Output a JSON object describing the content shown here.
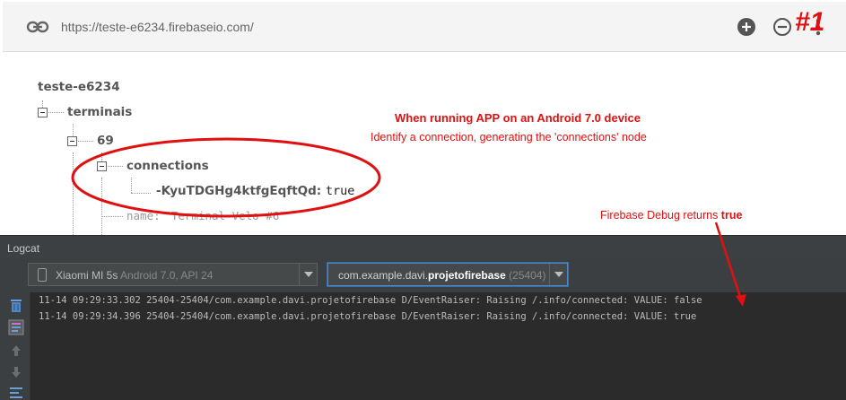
{
  "urlbar": {
    "url": "https://teste-e6234.firebaseio.com/",
    "link_icon": "link-icon",
    "add_icon": "add-circle-icon",
    "remove_icon": "remove-circle-icon",
    "more_icon": "more-vert-icon"
  },
  "tree": {
    "root": "teste-e6234",
    "terminais": "terminais",
    "id_69": "69",
    "connections": "connections",
    "connection_key": "-KyuTDGHg4ktfgEqftQd:",
    "connection_value": "true",
    "name_key": "name:",
    "name_value": "\"Terminal Velo #6\""
  },
  "annotations": {
    "badge": "#1",
    "line1": "When running APP on an Android 7.0 device",
    "line2": "Identify a connection, generating the 'connections' node",
    "debug_prefix": "Firebase Debug returns ",
    "debug_bold": "true"
  },
  "logcat": {
    "title": "Logcat",
    "device_name": "Xiaomi MI 5s",
    "device_detail": "Android 7.0, API 24",
    "process_prefix": "com.example.davi.",
    "process_bold": "projetofirebase",
    "process_pid": "(25404)",
    "lines": [
      "11-14 09:29:33.302 25404-25404/com.example.davi.projetofirebase D/EventRaiser: Raising /.info/connected: VALUE: false",
      "11-14 09:29:34.396 25404-25404/com.example.davi.projetofirebase D/EventRaiser: Raising /.info/connected: VALUE: true"
    ]
  },
  "colors": {
    "annotation_red": "#e01010",
    "logcat_background": "#2b2b2b",
    "toolbar_background": "#3c3f41",
    "focus_border": "#4a88c7"
  }
}
